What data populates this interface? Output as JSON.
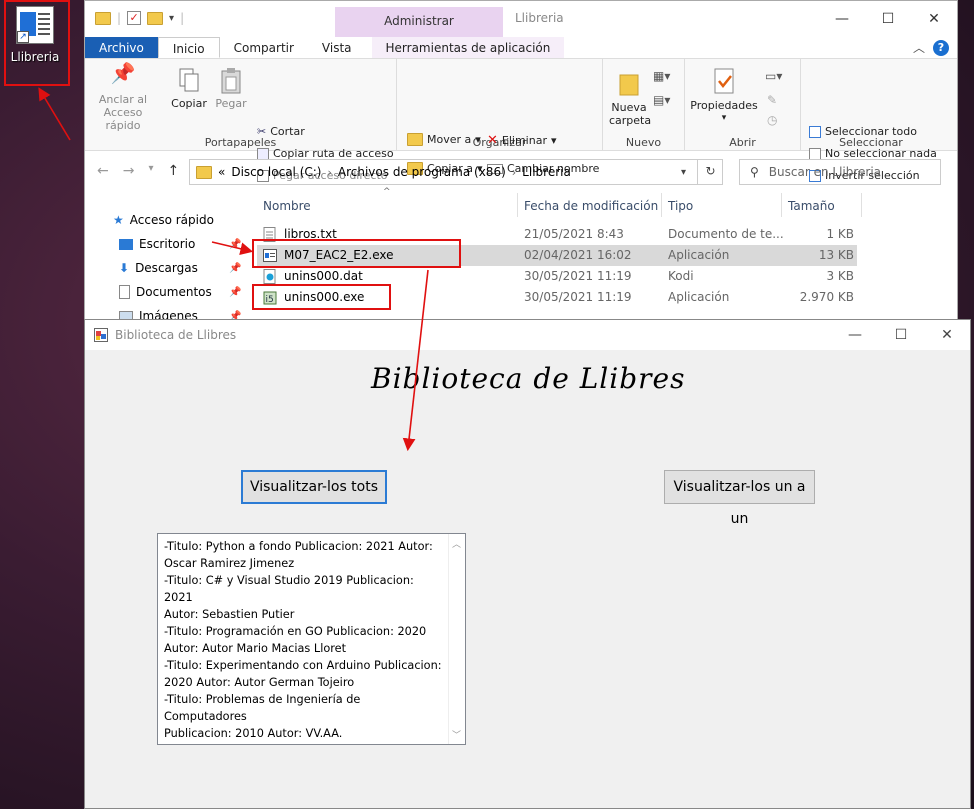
{
  "desktop": {
    "icon_label": "Llibreria"
  },
  "explorer": {
    "window_title": "Llibreria",
    "context_tab_header": "Administrar",
    "tabs": [
      "Archivo",
      "Inicio",
      "Compartir",
      "Vista",
      "Herramientas de aplicación"
    ],
    "ribbon": {
      "portapapeles": {
        "label": "Portapapeles",
        "anclar": "Anclar al",
        "anclar2": "Acceso rápido",
        "copiar": "Copiar",
        "pegar": "Pegar",
        "cortar": "Cortar",
        "copiar_ruta": "Copiar ruta de acceso",
        "pegar_acceso": "Pegar acceso directo"
      },
      "organizar": {
        "label": "Organizar",
        "mover": "Mover a",
        "copiar_a": "Copiar a",
        "eliminar": "Eliminar",
        "cambiar": "Cambiar nombre"
      },
      "nuevo": {
        "label": "Nuevo",
        "nueva1": "Nueva",
        "nueva2": "carpeta"
      },
      "abrir": {
        "label": "Abrir",
        "propiedades": "Propiedades"
      },
      "seleccionar": {
        "label": "Seleccionar",
        "todo": "Seleccionar todo",
        "nada": "No seleccionar nada",
        "invertir": "Invertir selección"
      }
    },
    "address": {
      "chevrons": "«",
      "parts": [
        "Disco local (C:)",
        "Archivos de programa (x86)",
        "Llibreria"
      ]
    },
    "search_placeholder": "Buscar en Llibreria",
    "nav": [
      "Acceso rápido",
      "Escritorio",
      "Descargas",
      "Documentos",
      "Imágenes"
    ],
    "columns": [
      "Nombre",
      "Fecha de modificación",
      "Tipo",
      "Tamaño"
    ],
    "files": [
      {
        "name": "libros.txt",
        "date": "21/05/2021 8:43",
        "type": "Documento de te...",
        "size": "1 KB"
      },
      {
        "name": "M07_EAC2_E2.exe",
        "date": "02/04/2021 16:02",
        "type": "Aplicación",
        "size": "13 KB"
      },
      {
        "name": "unins000.dat",
        "date": "30/05/2021 11:19",
        "type": "Kodi",
        "size": "3 KB"
      },
      {
        "name": "unins000.exe",
        "date": "30/05/2021 11:19",
        "type": "Aplicación",
        "size": "2.970 KB"
      }
    ]
  },
  "app": {
    "title": "Biblioteca de Llibres",
    "heading": "Biblioteca de Llibres",
    "btn_all": "Visualitzar-los tots",
    "btn_one": "Visualitzar-los un a un",
    "list_lines": [
      "-Titulo: Python a fondo Publicacion: 2021 Autor:",
      "Oscar Ramirez Jimenez",
      "-Titulo: C# y Visual Studio 2019 Publicacion: 2021",
      "Autor: Sebastien Putier",
      "-Titulo: Programación en GO Publicacion: 2020",
      "Autor: Autor Mario Macias Lloret",
      "-Titulo: Experimentando con Arduino Publicacion:",
      "2020 Autor: Autor German Tojeiro",
      "-Titulo: Problemas de Ingeniería de Computadores",
      "Publicacion: 2010 Autor: VV.AA."
    ]
  },
  "colors": {
    "accent": "#1a5fb4",
    "annotation": "#e01010",
    "context_tab": "#e9d3f0"
  }
}
